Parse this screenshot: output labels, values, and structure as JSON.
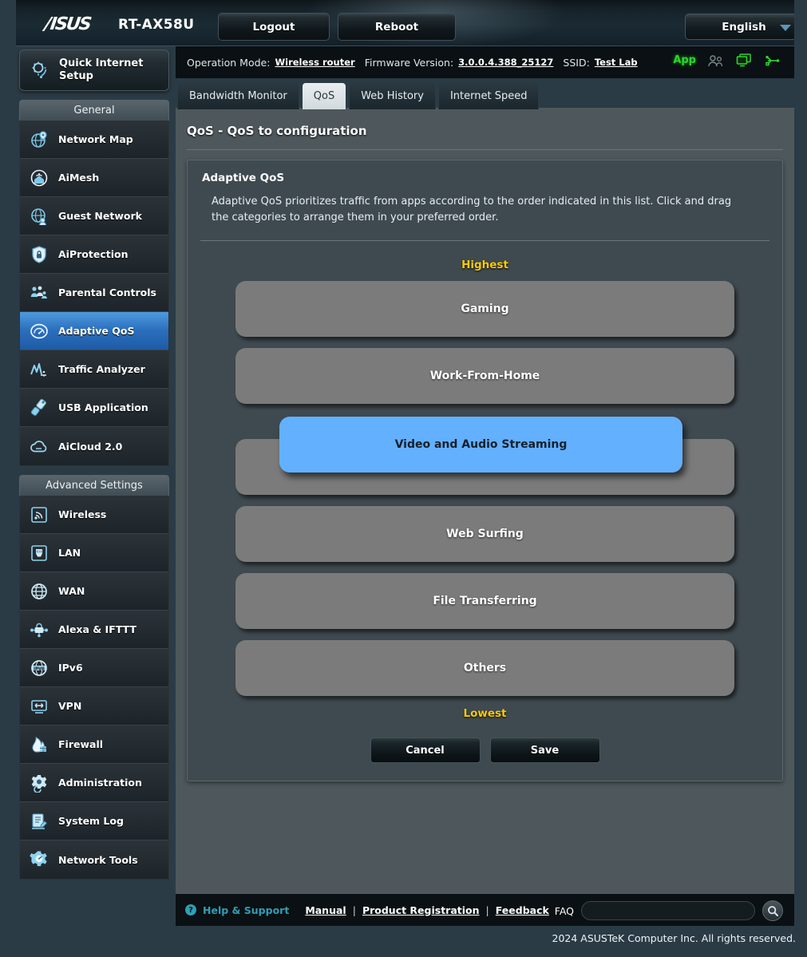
{
  "header": {
    "brand": "/ISUS",
    "model": "RT-AX58U",
    "logout_label": "Logout",
    "reboot_label": "Reboot",
    "language": "English"
  },
  "infobar": {
    "operation_mode_label": "Operation Mode:",
    "operation_mode_value": "Wireless router",
    "firmware_label": "Firmware Version:",
    "firmware_value": "3.0.0.4.388_25127",
    "ssid_label": "SSID:",
    "ssid_value": "Test Lab",
    "icons": {
      "app": "App",
      "users": "users-icon",
      "monitor": "monitor-icon",
      "usb": "usb-icon"
    }
  },
  "tabs": [
    {
      "label": "Bandwidth Monitor",
      "active": false
    },
    {
      "label": "QoS",
      "active": true
    },
    {
      "label": "Web History",
      "active": false
    },
    {
      "label": "Internet Speed",
      "active": false
    }
  ],
  "page": {
    "title": "QoS - QoS to configuration",
    "card_title": "Adaptive QoS",
    "card_desc": "Adaptive QoS prioritizes traffic from apps according to the order indicated in this list. Click and drag the categories to arrange them in your preferred order.",
    "highest_label": "Highest",
    "lowest_label": "Lowest",
    "cancel_label": "Cancel",
    "save_label": "Save"
  },
  "qos_categories": [
    {
      "label": "Gaming",
      "state": "normal"
    },
    {
      "label": "Work-From-Home",
      "state": "normal"
    },
    {
      "label": "Video and Audio Streaming",
      "state": "dragging"
    },
    {
      "label": "Web Surfing",
      "state": "normal"
    },
    {
      "label": "File Transferring",
      "state": "normal"
    },
    {
      "label": "Others",
      "state": "normal"
    }
  ],
  "colors": {
    "drag_highlight": "#63b0ff",
    "category_bar": "#7b7b7b",
    "priority_text": "#ffcc00",
    "active_nav": "#2b6fbd",
    "help_link": "#2f9fb5",
    "app_icon": "#2dd62d"
  },
  "sidebar": {
    "quick_setup": "Quick Internet Setup",
    "general_header": "General",
    "advanced_header": "Advanced Settings",
    "general_items": [
      {
        "label": "Network Map",
        "icon": "network-map-icon",
        "active": false
      },
      {
        "label": "AiMesh",
        "icon": "aimesh-icon",
        "active": false
      },
      {
        "label": "Guest Network",
        "icon": "guest-network-icon",
        "active": false
      },
      {
        "label": "AiProtection",
        "icon": "shield-lock-icon",
        "active": false
      },
      {
        "label": "Parental Controls",
        "icon": "parental-controls-icon",
        "active": false
      },
      {
        "label": "Adaptive QoS",
        "icon": "gauge-icon",
        "active": true
      },
      {
        "label": "Traffic Analyzer",
        "icon": "traffic-analyzer-icon",
        "active": false
      },
      {
        "label": "USB Application",
        "icon": "usb-application-icon",
        "active": false
      },
      {
        "label": "AiCloud 2.0",
        "icon": "cloud-icon",
        "active": false
      }
    ],
    "advanced_items": [
      {
        "label": "Wireless",
        "icon": "wireless-icon"
      },
      {
        "label": "LAN",
        "icon": "lan-icon"
      },
      {
        "label": "WAN",
        "icon": "wan-globe-icon"
      },
      {
        "label": "Alexa & IFTTT",
        "icon": "alexa-ifttt-icon"
      },
      {
        "label": "IPv6",
        "icon": "ipv6-icon"
      },
      {
        "label": "VPN",
        "icon": "vpn-icon"
      },
      {
        "label": "Firewall",
        "icon": "firewall-icon"
      },
      {
        "label": "Administration",
        "icon": "administration-gear-icon"
      },
      {
        "label": "System Log",
        "icon": "system-log-icon"
      },
      {
        "label": "Network Tools",
        "icon": "network-tools-icon"
      }
    ]
  },
  "footer": {
    "help_support": "Help & Support",
    "manual": "Manual",
    "product_registration": "Product Registration",
    "feedback": "Feedback",
    "separator": "|",
    "faq_label": "FAQ",
    "faq_value": "",
    "copyright": "2024 ASUSTeK Computer Inc. All rights reserved."
  }
}
